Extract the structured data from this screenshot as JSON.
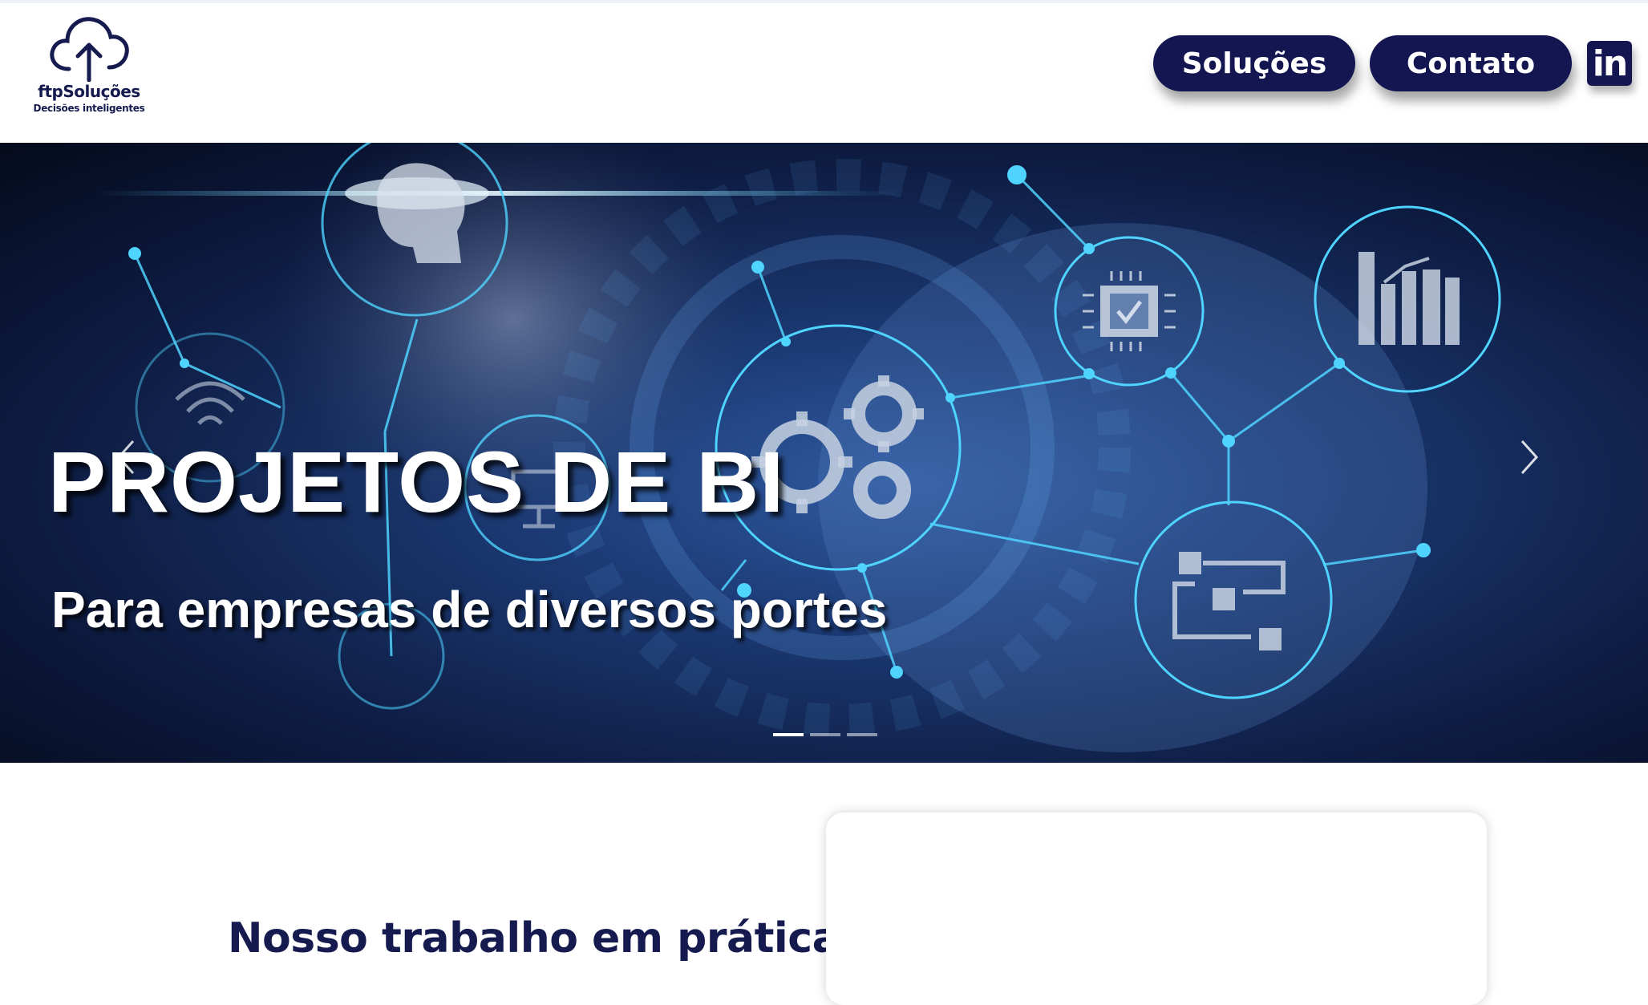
{
  "header": {
    "logo": {
      "icon": "cloud-upload-icon",
      "name": "ftpSoluções",
      "tagline": "Decisões inteligentes"
    },
    "nav": {
      "solucoes_label": "Soluções",
      "contato_label": "Contato",
      "linkedin_label": "in",
      "linkedin_icon": "linkedin-icon"
    }
  },
  "hero": {
    "title": "PROJETOS DE BI",
    "subtitle": "Para empresas de diversos portes",
    "prev_icon": "chevron-left-icon",
    "next_icon": "chevron-right-icon",
    "slides_count": 3,
    "active_slide": 1
  },
  "section": {
    "heading": "Nosso trabalho em prática:"
  },
  "colors": {
    "brand_navy": "#131651",
    "text_navy": "#151a4f",
    "hero_glow": "#4fd3ff"
  }
}
